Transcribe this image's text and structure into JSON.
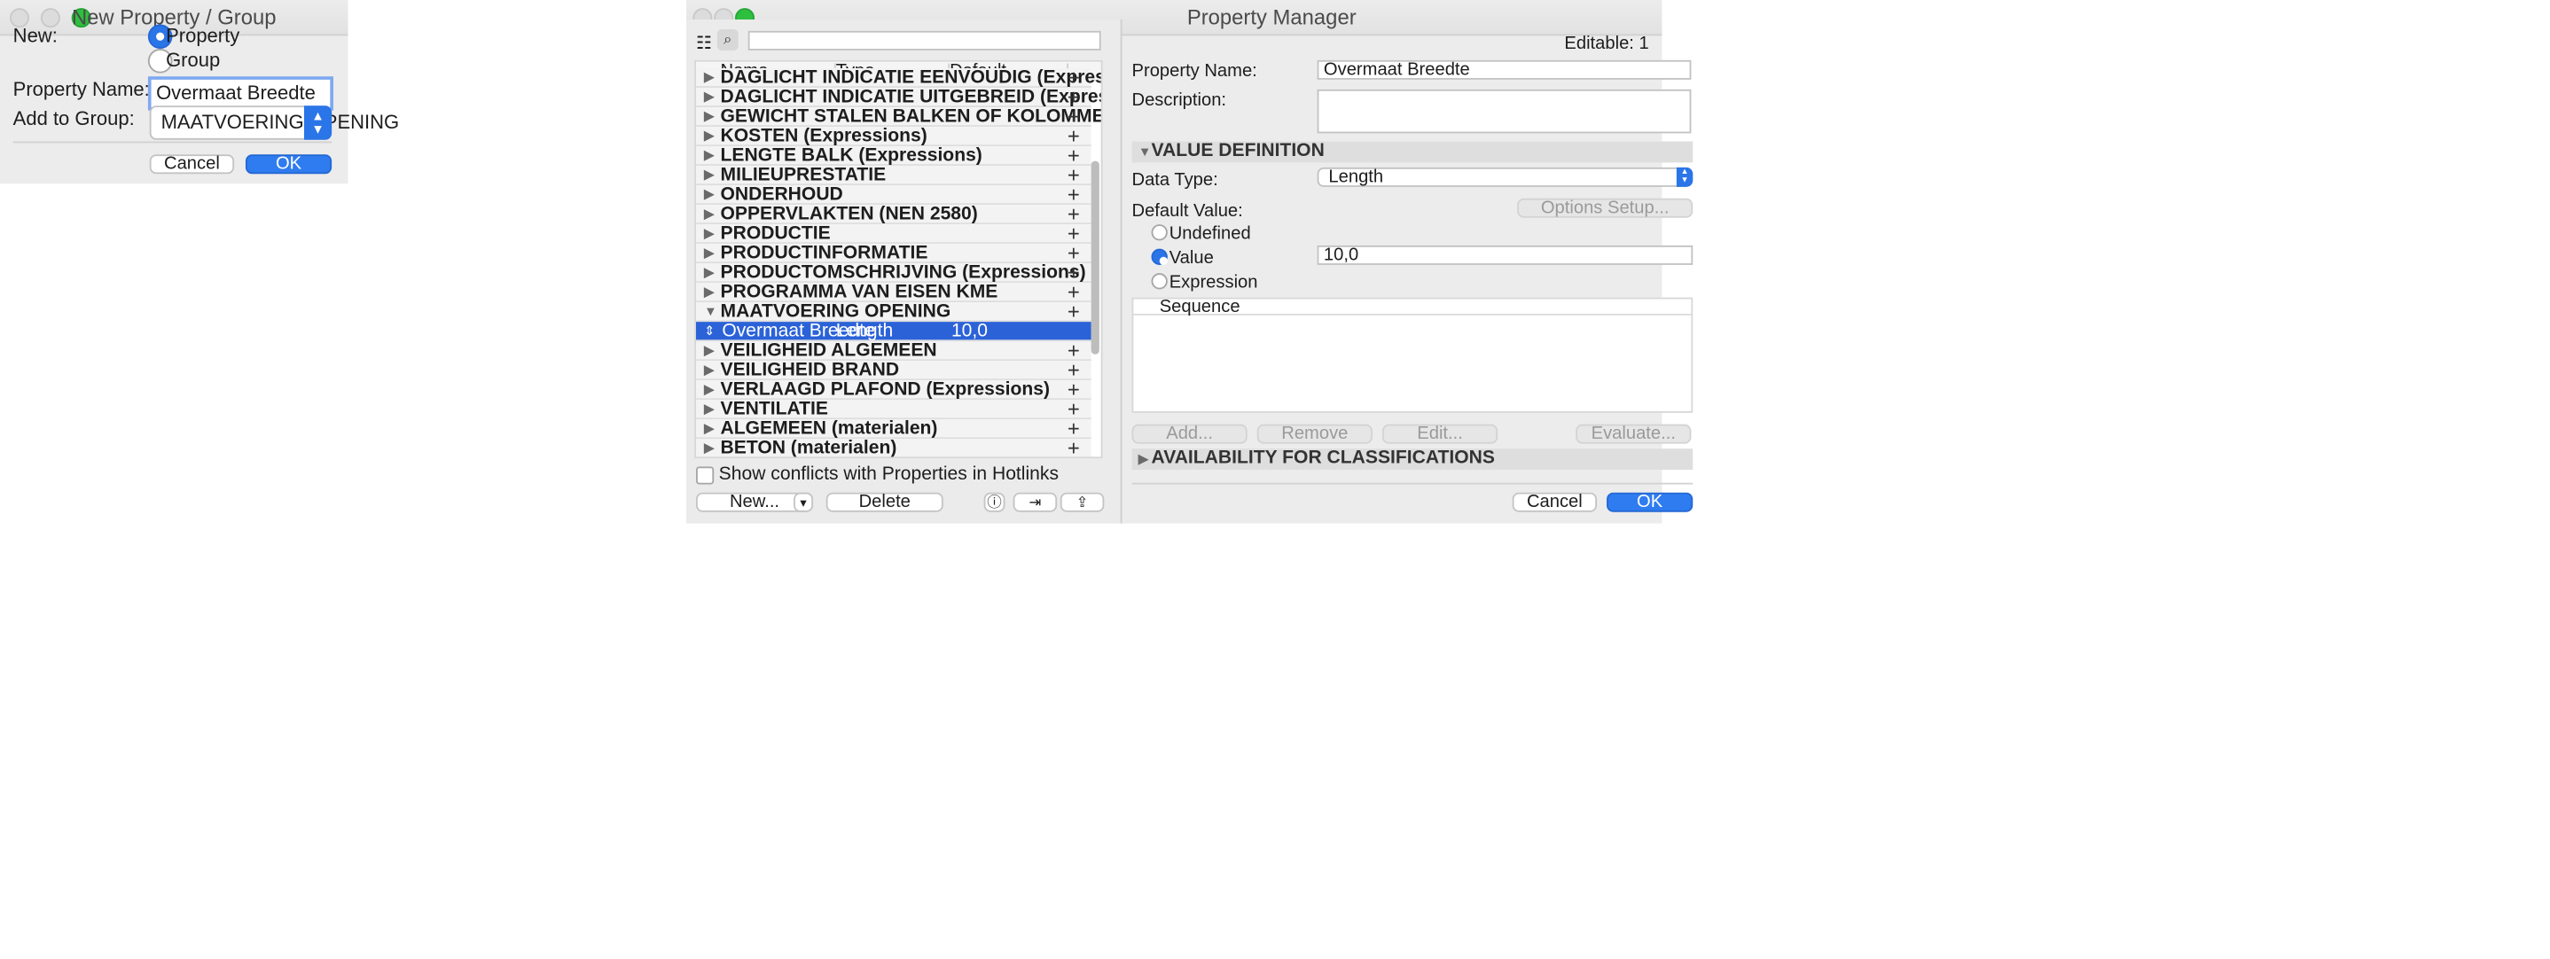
{
  "new_dialog": {
    "title": "New Property / Group",
    "new_label": "New:",
    "radio_property": "Property",
    "radio_group": "Group",
    "property_name_label": "Property Name:",
    "property_name_value": "Overmaat Breedte",
    "add_to_group_label": "Add to Group:",
    "add_to_group_value": "MAATVOERING OPENING",
    "cancel": "Cancel",
    "ok": "OK"
  },
  "manager": {
    "title": "Property Manager",
    "search_placeholder": "",
    "columns": [
      "Name",
      "Type",
      "Default"
    ],
    "groups": [
      "DAGLICHT INDICATIE EENVOUDIG (Expressions)",
      "DAGLICHT INDICATIE UITGEBREID (Expressions)",
      "GEWICHT STALEN BALKEN OF KOLOMMEN (Expressions) (NL)",
      "KOSTEN (Expressions)",
      "LENGTE BALK (Expressions)",
      "MILIEUPRESTATIE",
      "ONDERHOUD",
      "OPPERVLAKTEN (NEN 2580)",
      "PRODUCTIE",
      "PRODUCTINFORMATIE",
      "PRODUCTOMSCHRIJVING (Expressions)",
      "PROGRAMMA VAN EISEN KME",
      "MAATVOERING OPENING"
    ],
    "selected_row": {
      "name": "Overmaat Breedte",
      "type": "Length",
      "default": "10,0"
    },
    "groups_after": [
      "VEILIGHEID ALGEMEEN",
      "VEILIGHEID BRAND",
      "VERLAAGD PLAFOND (Expressions)",
      "VENTILATIE",
      "ALGEMEEN (materialen)",
      "BETON (materialen)"
    ],
    "show_conflicts": "Show conflicts with Properties in Hotlinks",
    "new_button": "New...",
    "delete_button": "Delete",
    "editable": "Editable: 1",
    "property_name_label": "Property Name:",
    "property_name_value": "Overmaat Breedte",
    "description_label": "Description:",
    "description_value": "",
    "value_definition": "VALUE DEFINITION",
    "data_type_label": "Data Type:",
    "data_type_value": "Length",
    "default_value_label": "Default Value:",
    "options_setup": "Options Setup...",
    "opt_undefined": "Undefined",
    "opt_value": "Value",
    "opt_expression": "Expression",
    "value_input": "10,0",
    "sequence_header": "Sequence",
    "add": "Add...",
    "remove": "Remove",
    "edit": "Edit...",
    "evaluate": "Evaluate...",
    "availability": "AVAILABILITY FOR CLASSIFICATIONS",
    "cancel": "Cancel",
    "ok": "OK"
  }
}
